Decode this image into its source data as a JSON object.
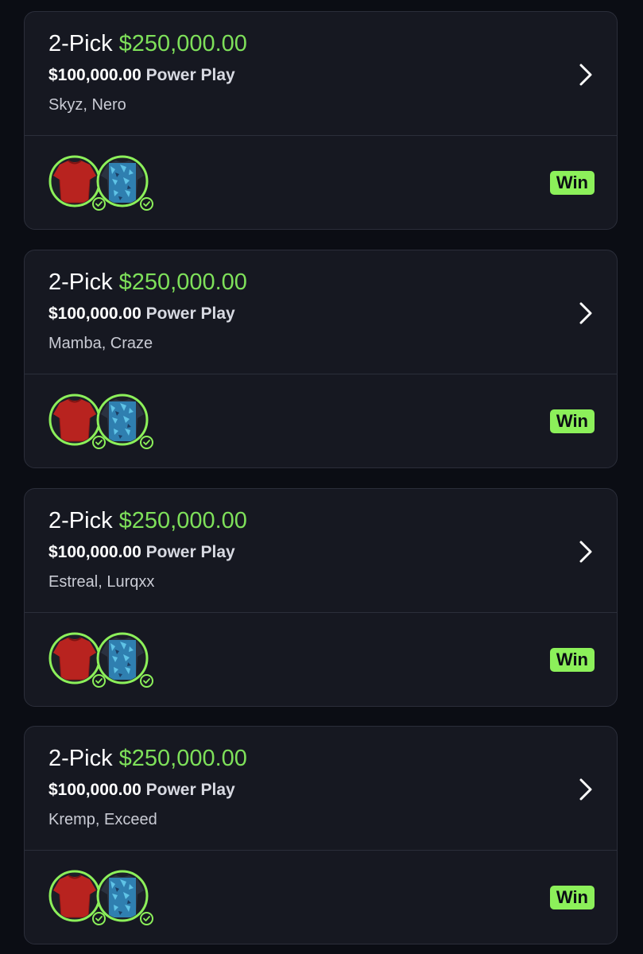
{
  "entries": [
    {
      "pick_label": "2-Pick",
      "payout": "$250,000.00",
      "entry_amount": "$100,000.00",
      "play_type": "Power Play",
      "players": "Skyz, Nero",
      "result": "Win"
    },
    {
      "pick_label": "2-Pick",
      "payout": "$250,000.00",
      "entry_amount": "$100,000.00",
      "play_type": "Power Play",
      "players": "Mamba, Craze",
      "result": "Win"
    },
    {
      "pick_label": "2-Pick",
      "payout": "$250,000.00",
      "entry_amount": "$100,000.00",
      "play_type": "Power Play",
      "players": "Estreal, Lurqxx",
      "result": "Win"
    },
    {
      "pick_label": "2-Pick",
      "payout": "$250,000.00",
      "entry_amount": "$100,000.00",
      "play_type": "Power Play",
      "players": "Kremp, Exceed",
      "result": "Win"
    }
  ],
  "icons": {
    "open": "chevron-right-icon",
    "pick_status": "check-circle-icon",
    "jersey_1": "red-jersey-icon",
    "jersey_2": "blue-camo-jersey-icon"
  },
  "colors": {
    "background": "#0b0d14",
    "card": "#161821",
    "card_border": "#2b2e3a",
    "payout_green": "#7ee05a",
    "accent_green": "#8cf05a",
    "jersey_red": "#b8231f",
    "jersey_blue": "#2f7fb0"
  }
}
